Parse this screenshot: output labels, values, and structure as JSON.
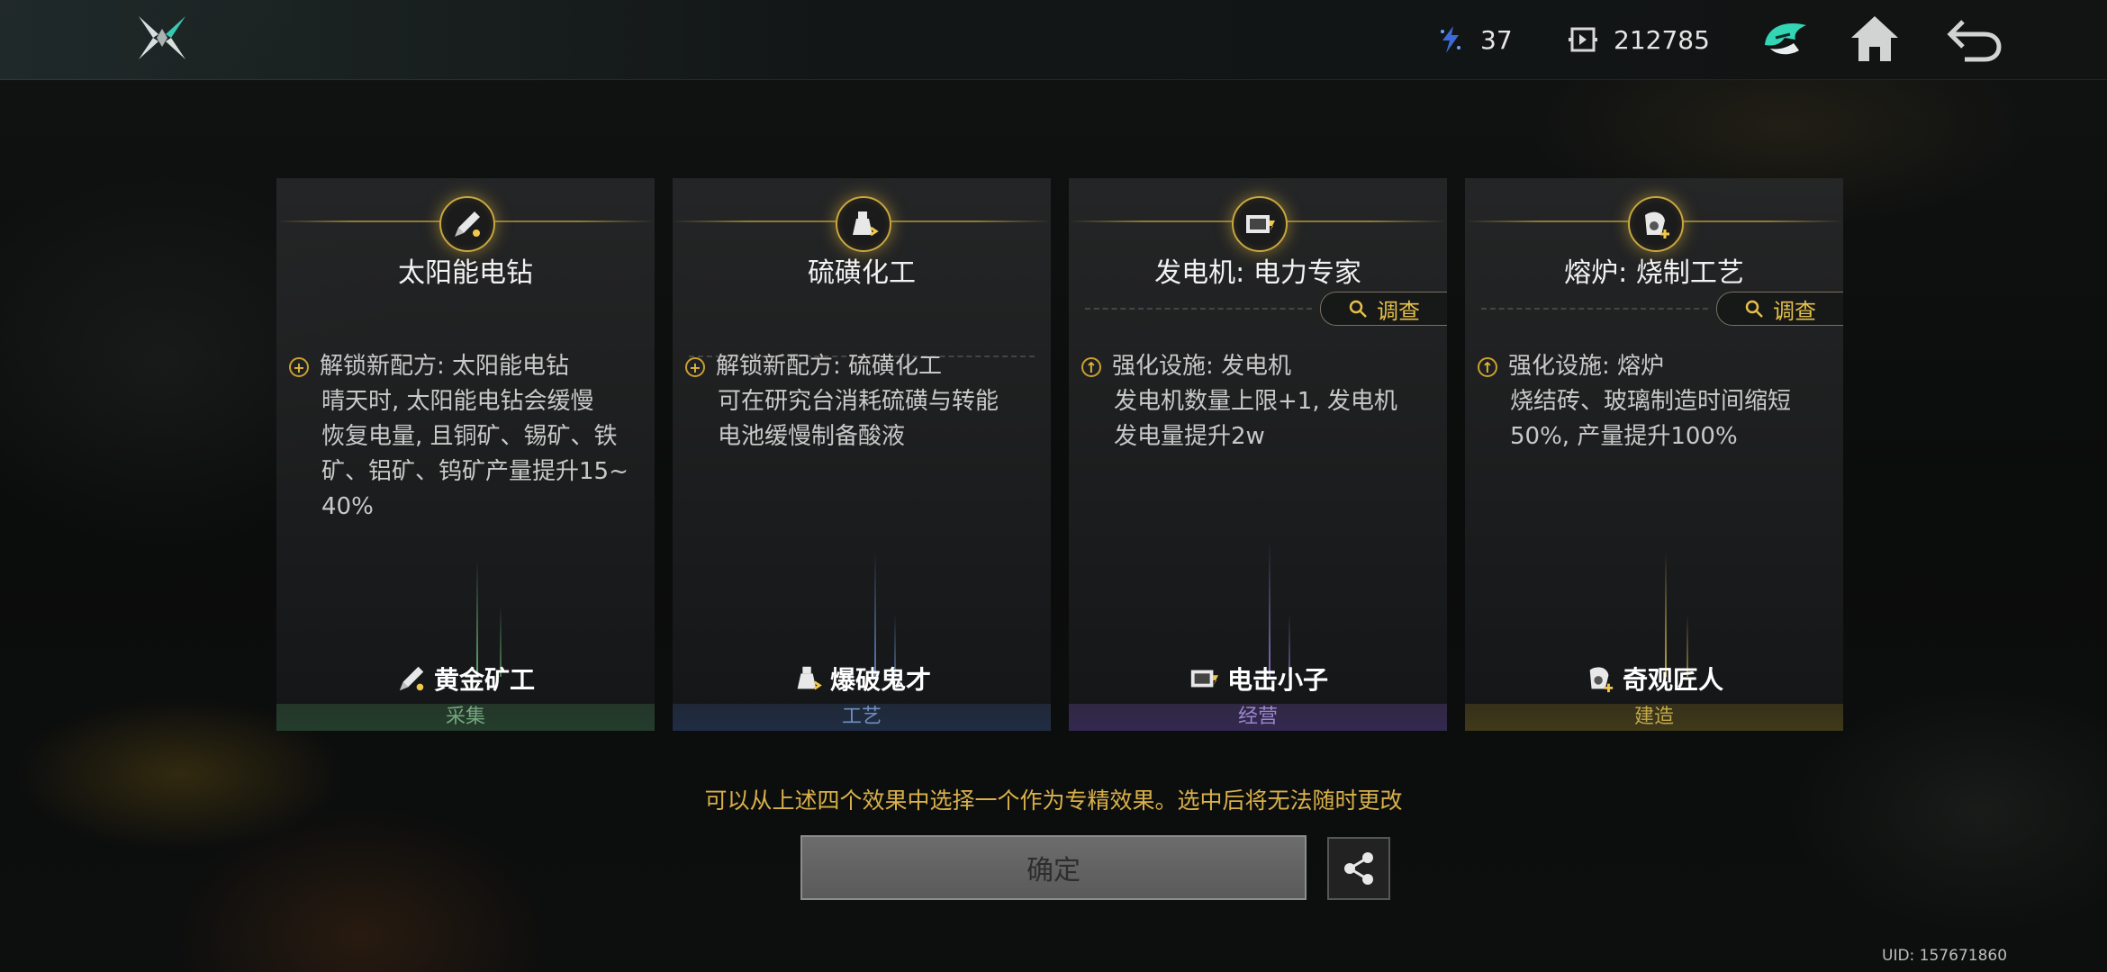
{
  "topbar": {
    "resource1": {
      "icon": "energy-crystal-icon",
      "value": "37"
    },
    "resource2": {
      "icon": "currency-chip-icon",
      "value": "212785"
    },
    "icons": [
      "helmet-icon",
      "home-icon",
      "back-arrow-icon"
    ]
  },
  "cards": [
    {
      "title": "太阳能电钻",
      "emblem_icon": "solar-drill-icon",
      "investigate": "",
      "effect_type": "unlock",
      "effect_head": "解锁新配方: 太阳能电钻",
      "effect_lines": [
        "晴天时, 太阳能电钻会缓慢",
        "恢复电量, 且铜矿、锡矿、铁",
        "矿、铝矿、钨矿产量提升15~",
        "40%"
      ],
      "role": "黄金矿工",
      "category": "采集",
      "color": "#74a57e"
    },
    {
      "title": "硫磺化工",
      "emblem_icon": "sulfur-bottle-icon",
      "investigate": "",
      "effect_type": "unlock",
      "effect_head": "解锁新配方: 硫磺化工",
      "effect_lines": [
        "可在研究台消耗硫磺与转能",
        "电池缓慢制备酸液"
      ],
      "role": "爆破鬼才",
      "category": "工艺",
      "color": "#6f8fc2"
    },
    {
      "title": "发电机: 电力专家",
      "emblem_icon": "generator-icon",
      "investigate": "调查",
      "effect_type": "upgrade",
      "effect_head": "强化设施: 发电机",
      "effect_lines": [
        "发电机数量上限+1, 发电机",
        "发电量提升2w"
      ],
      "role": "电击小子",
      "category": "经营",
      "color": "#9c86cf"
    },
    {
      "title": "熔炉: 烧制工艺",
      "emblem_icon": "furnace-icon",
      "investigate": "调查",
      "effect_type": "upgrade",
      "effect_head": "强化设施: 熔炉",
      "effect_lines": [
        "烧结砖、玻璃制造时间缩短",
        "50%, 产量提升100%"
      ],
      "role": "奇观匠人",
      "category": "建造",
      "color": "#c3a947"
    }
  ],
  "hint": "可以从上述四个效果中选择一个作为专精效果。选中后将无法随时更改",
  "confirm_label": "确定",
  "share_icon": "share-icon",
  "uid": "UID: 157671860"
}
